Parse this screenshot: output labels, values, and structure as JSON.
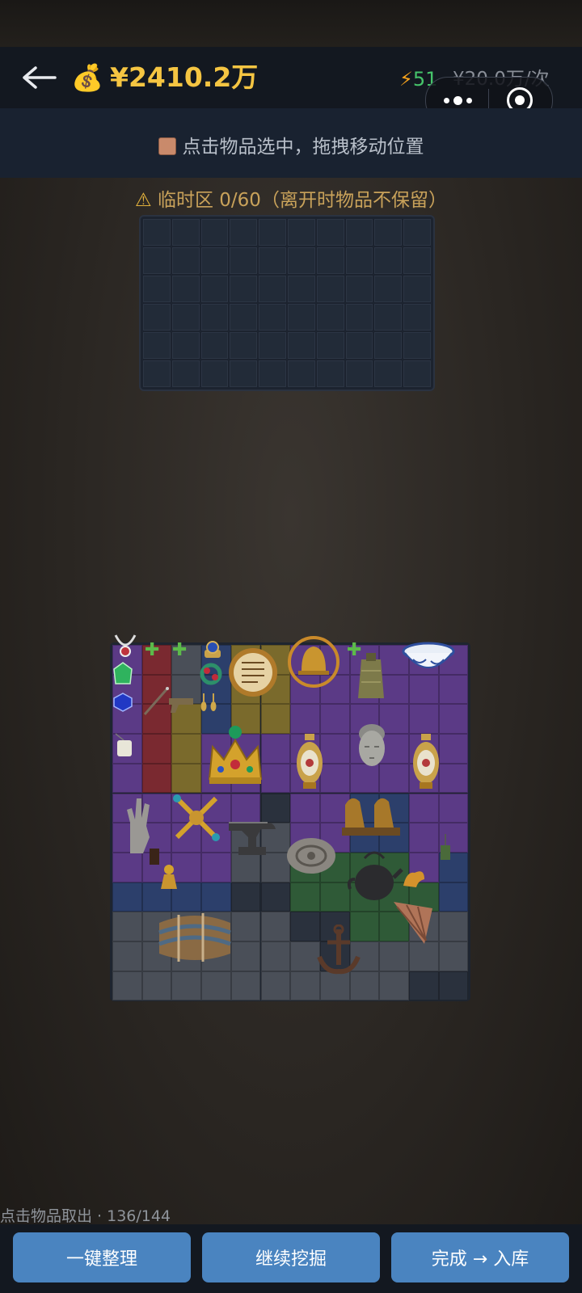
{
  "header": {
    "money": "¥2410.2万",
    "energy": "51",
    "cost": "¥20.0万/次",
    "icons": {
      "back": "back-arrow-icon",
      "bag": "money-bag-icon",
      "bolt": "lightning-icon"
    }
  },
  "hint": {
    "text": "点击物品选中，拖拽移动位置"
  },
  "temp_zone": {
    "title": "临时区 0/60（离开时物品不保留）"
  },
  "grid": {
    "items": [
      "necklace",
      "puzzle-piece",
      "puzzle-piece",
      "ring",
      "emerald-gem",
      "papyrus-scroll",
      "bronze-bell",
      "puzzle-piece",
      "bronze-chime-bell",
      "porcelain-bowl",
      "ruby-bracelet",
      "sapphire-gem",
      "wand",
      "pistol",
      "earrings",
      "jade-pendant",
      "gold-crown",
      "cloisonne-vase",
      "stone-buddha-head",
      "cloisonne-vase",
      "stone-hand",
      "golden-vajra",
      "iron-anvil",
      "foo-dog-statues",
      "small-lacquer-box",
      "small-gold-figurine",
      "stone-relief-disc",
      "cast-iron-teapot",
      "gold-dragon-figurine",
      "wind-chime",
      "woven-blanket",
      "wooden-fan",
      "ship-anchor"
    ]
  },
  "footer": {
    "counter": "点击物品取出 · 136/144",
    "btn_sort": "一键整理",
    "btn_dig": "继续挖掘",
    "btn_done": "完成 → 入库"
  },
  "colors": {
    "gold": "#f5c542",
    "purple": "#5b3a86",
    "red": "#7a2930",
    "olive": "#7a6a2c",
    "blue": "#2c3f6b",
    "green": "#2f5a37",
    "gray": "#4a4f58",
    "button": "#4a84c0"
  }
}
